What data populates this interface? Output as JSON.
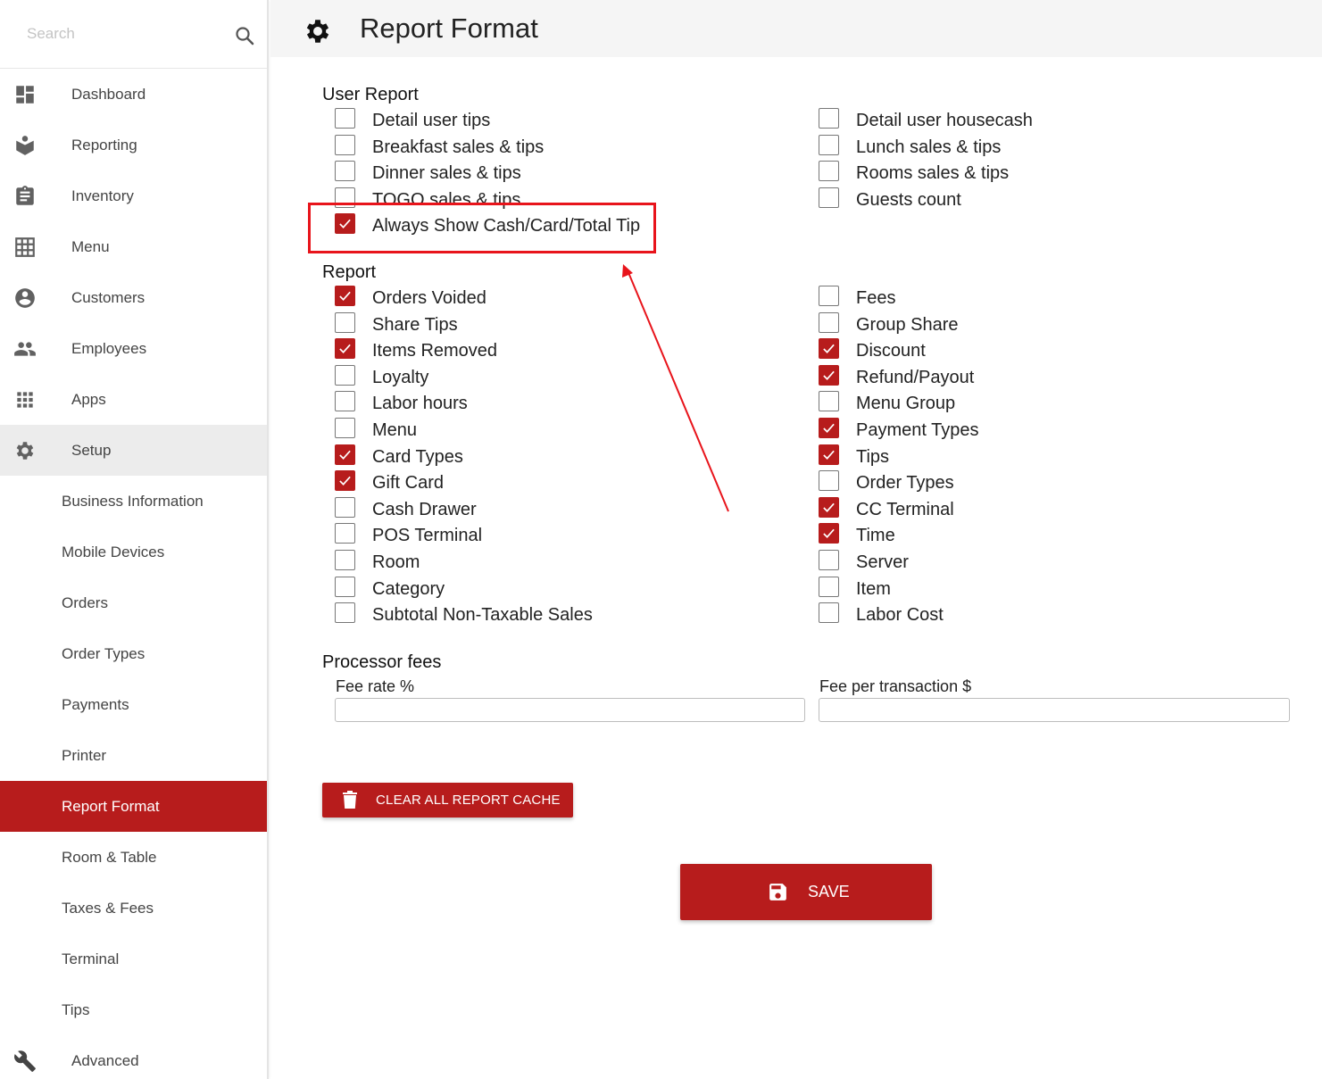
{
  "sidebar": {
    "search_placeholder": "Search",
    "items": [
      {
        "label": "Dashboard",
        "icon": "dashboard-icon"
      },
      {
        "label": "Reporting",
        "icon": "reporting-icon"
      },
      {
        "label": "Inventory",
        "icon": "clipboard-icon"
      },
      {
        "label": "Menu",
        "icon": "grid-icon"
      },
      {
        "label": "Customers",
        "icon": "account-circle-icon"
      },
      {
        "label": "Employees",
        "icon": "people-icon"
      },
      {
        "label": "Apps",
        "icon": "apps-icon"
      },
      {
        "label": "Setup",
        "icon": "gear-icon"
      }
    ],
    "setup_items": [
      "Business Information",
      "Mobile Devices",
      "Orders",
      "Order Types",
      "Payments",
      "Printer",
      "Report Format",
      "Room & Table",
      "Taxes & Fees",
      "Terminal",
      "Tips"
    ],
    "selected_item": "Report Format",
    "advanced": {
      "label": "Advanced",
      "icon": "wrench-icon"
    }
  },
  "header": {
    "title": "Report Format",
    "icon": "gear-icon"
  },
  "user_report": {
    "title": "User Report",
    "left": [
      {
        "label": "Detail user tips",
        "checked": false
      },
      {
        "label": "Breakfast sales & tips",
        "checked": false
      },
      {
        "label": "Dinner sales & tips",
        "checked": false
      },
      {
        "label": "TOGO sales & tips",
        "checked": false
      },
      {
        "label": "Always Show Cash/Card/Total Tip",
        "checked": true
      }
    ],
    "right": [
      {
        "label": "Detail user housecash",
        "checked": false
      },
      {
        "label": "Lunch sales & tips",
        "checked": false
      },
      {
        "label": "Rooms sales & tips",
        "checked": false
      },
      {
        "label": "Guests count",
        "checked": false
      }
    ]
  },
  "report": {
    "title": "Report",
    "left": [
      {
        "label": "Orders Voided",
        "checked": true
      },
      {
        "label": "Share Tips",
        "checked": false
      },
      {
        "label": "Items Removed",
        "checked": true
      },
      {
        "label": "Loyalty",
        "checked": false
      },
      {
        "label": "Labor hours",
        "checked": false
      },
      {
        "label": "Menu",
        "checked": false
      },
      {
        "label": "Card Types",
        "checked": true
      },
      {
        "label": "Gift Card",
        "checked": true
      },
      {
        "label": "Cash Drawer",
        "checked": false
      },
      {
        "label": "POS Terminal",
        "checked": false
      },
      {
        "label": "Room",
        "checked": false
      },
      {
        "label": "Category",
        "checked": false
      },
      {
        "label": "Subtotal Non-Taxable Sales",
        "checked": false
      }
    ],
    "right": [
      {
        "label": "Fees",
        "checked": false
      },
      {
        "label": "Group Share",
        "checked": false
      },
      {
        "label": "Discount",
        "checked": true
      },
      {
        "label": "Refund/Payout",
        "checked": true
      },
      {
        "label": "Menu Group",
        "checked": false
      },
      {
        "label": "Payment Types",
        "checked": true
      },
      {
        "label": "Tips",
        "checked": true
      },
      {
        "label": "Order Types",
        "checked": false
      },
      {
        "label": "CC Terminal",
        "checked": true
      },
      {
        "label": "Time",
        "checked": true
      },
      {
        "label": "Server",
        "checked": false
      },
      {
        "label": "Item",
        "checked": false
      },
      {
        "label": "Labor Cost",
        "checked": false
      }
    ]
  },
  "processor_fees": {
    "title": "Processor fees",
    "fee_rate_label": "Fee rate %",
    "fee_rate_value": "",
    "fee_per_transaction_label": "Fee per transaction $",
    "fee_per_transaction_value": ""
  },
  "buttons": {
    "clear_cache": "CLEAR ALL REPORT CACHE",
    "save": "SAVE"
  },
  "colors": {
    "accent": "#b71c1c",
    "annotation": "#e8141b"
  }
}
